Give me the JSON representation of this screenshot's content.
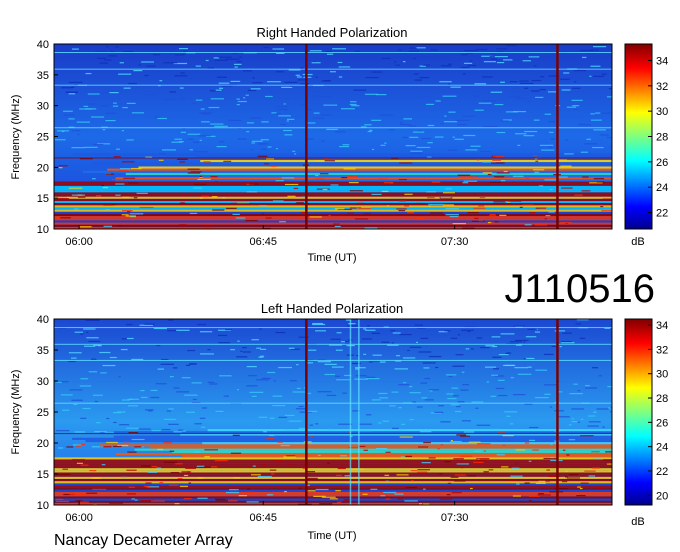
{
  "station_id": "J110516",
  "instrument": "Nancay Decameter Array",
  "chart_data": [
    {
      "type": "heatmap",
      "title": "Right Handed Polarization",
      "xlabel": "Time (UT)",
      "ylabel": "Frequency (MHz)",
      "x_ticks": [
        "06:00",
        "06:45",
        "07:30"
      ],
      "y_ticks": [
        "10",
        "15",
        "20",
        "25",
        "30",
        "35",
        "40"
      ],
      "ylim": [
        10,
        40
      ],
      "colorbar_label": "dB",
      "colorbar_ticks": [
        "22",
        "24",
        "26",
        "28",
        "30",
        "32",
        "34"
      ],
      "colorbar_range": [
        20.7,
        35.3
      ],
      "colormap": "jet",
      "grid": false
    },
    {
      "type": "heatmap",
      "title": "Left Handed Polarization",
      "xlabel": "Time (UT)",
      "ylabel": "Frequency (MHz)",
      "x_ticks": [
        "06:00",
        "06:45",
        "07:30"
      ],
      "y_ticks": [
        "10",
        "15",
        "20",
        "25",
        "30",
        "35",
        "40"
      ],
      "ylim": [
        10,
        40
      ],
      "colorbar_label": "dB",
      "colorbar_ticks": [
        "20",
        "22",
        "24",
        "26",
        "28",
        "30",
        "32",
        "34"
      ],
      "colorbar_range": [
        19.2,
        34.5
      ],
      "colormap": "jet",
      "grid": false
    }
  ]
}
